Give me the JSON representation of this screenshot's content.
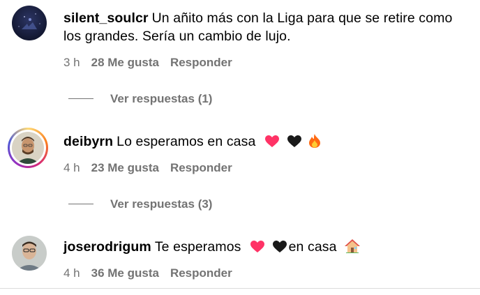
{
  "comments": [
    {
      "username": "silent_soulcr",
      "text": "Un añito más con la Liga para que se retire como los grandes. Sería un cambio de lujo.",
      "time": "3 h",
      "likes": "28 Me gusta",
      "reply_label": "Responder",
      "view_replies": "Ver respuestas (1)"
    },
    {
      "username": "deibyrn",
      "text": "Lo esperamos en casa",
      "time": "4 h",
      "likes": "23 Me gusta",
      "reply_label": "Responder",
      "view_replies": "Ver respuestas (3)"
    },
    {
      "username": "joserodrigum",
      "text_before": "Te esperamos",
      "text_after": "en casa",
      "time": "4 h",
      "likes": "36 Me gusta",
      "reply_label": "Responder"
    }
  ],
  "colors": {
    "muted": "#737373",
    "heart_pink": "#ff3366",
    "heart_black": "#1a1a1a",
    "divider": "#dbdbdb"
  },
  "icons": [
    "pink-heart-icon",
    "black-heart-icon",
    "fire-icon",
    "house-icon"
  ]
}
